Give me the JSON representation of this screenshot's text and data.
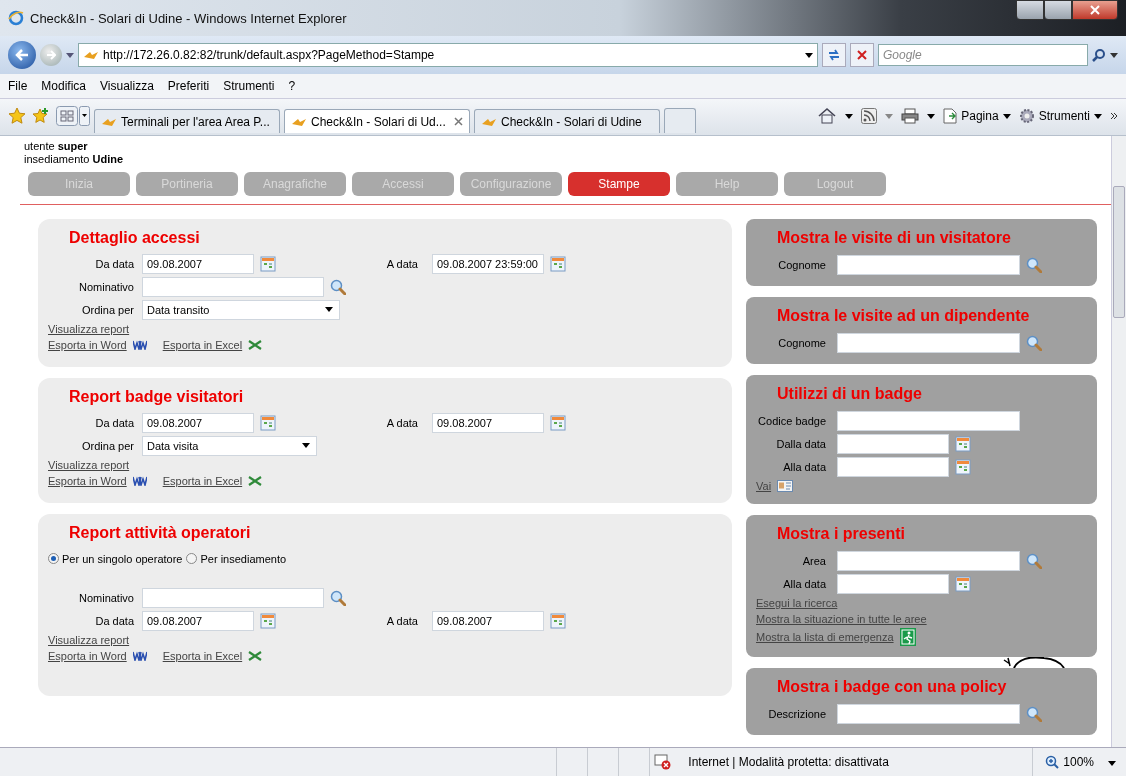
{
  "window": {
    "title": "Check&In - Solari di Udine - Windows Internet Explorer"
  },
  "address_bar": {
    "url": "http://172.26.0.82:82/trunk/default.aspx?PageMethod=Stampe"
  },
  "search": {
    "placeholder": "Google"
  },
  "menu": [
    "File",
    "Modifica",
    "Visualizza",
    "Preferiti",
    "Strumenti",
    "?"
  ],
  "tabs": [
    {
      "label": "Terminali per l'area Area P...",
      "selected": false
    },
    {
      "label": "Check&In - Solari di Ud...",
      "selected": true
    },
    {
      "label": "Check&In - Solari di Udine",
      "selected": false
    }
  ],
  "toolbar": [
    "Pagina",
    "Strumenti"
  ],
  "header": {
    "user": "utente **super**",
    "site": "insediamento **Udine**"
  },
  "nav": [
    {
      "label": "Inizia",
      "selected": false
    },
    {
      "label": "Portineria",
      "selected": false
    },
    {
      "label": "Anagrafiche",
      "selected": false
    },
    {
      "label": "Accessi",
      "selected": false
    },
    {
      "label": "Configurazione",
      "selected": false
    },
    {
      "label": "Stampe",
      "selected": true
    },
    {
      "label": "Help",
      "selected": false
    },
    {
      "label": "Logout",
      "selected": false
    }
  ],
  "left_panels": [
    {
      "title": "Dettaglio accessi",
      "rows": [
        {
          "kind": "dates",
          "from": {
            "label": "Da data",
            "value": "09.08.2007"
          },
          "to": {
            "label": "A data",
            "value": "09.08.2007 23:59:00"
          }
        },
        {
          "kind": "search",
          "label": "Nominativo"
        },
        {
          "kind": "select",
          "label": "Ordina per",
          "value": "Data transito",
          "wide": true
        },
        {
          "kind": "link",
          "label": "Visualizza report"
        },
        {
          "kind": "exports",
          "links": [
            {
              "label": "Esporta in Word",
              "kind": "word"
            },
            {
              "label": "Esporta in Excel",
              "kind": "excel"
            }
          ]
        }
      ]
    },
    {
      "title": "Report badge visitatori",
      "rows": [
        {
          "kind": "dates",
          "from": {
            "label": "Da data",
            "value": "09.08.2007"
          },
          "to": {
            "label": "A data",
            "value": "09.08.2007"
          }
        },
        {
          "kind": "select",
          "label": "Ordina per",
          "value": "Data visita",
          "wide": false
        },
        {
          "kind": "link",
          "label": "Visualizza report"
        },
        {
          "kind": "exports",
          "links": [
            {
              "label": "Esporta in Word",
              "kind": "word"
            },
            {
              "label": "Esporta in Excel",
              "kind": "excel"
            }
          ]
        }
      ]
    },
    {
      "title": "Report attività operatori",
      "rows": [
        {
          "kind": "radios",
          "options": [
            {
              "label": "Per un singolo operatore",
              "selected": true
            },
            {
              "label": "Per insediamento",
              "selected": false
            }
          ]
        },
        {
          "kind": "search",
          "label": "Nominativo"
        },
        {
          "kind": "dates",
          "from": {
            "label": "Da data",
            "value": "09.08.2007"
          },
          "to": {
            "label": "A data",
            "value": "09.08.2007"
          }
        },
        {
          "kind": "link",
          "label": "Visualizza report"
        },
        {
          "kind": "exports",
          "links": [
            {
              "label": "Esporta in Word",
              "kind": "word"
            },
            {
              "label": "Esporta in Excel",
              "kind": "excel"
            }
          ]
        }
      ]
    }
  ],
  "right_panels": [
    {
      "title": "Mostra le visite di un visitatore",
      "rows": [
        {
          "kind": "search",
          "label": "Cognome"
        }
      ]
    },
    {
      "title": "Mostra le visite ad un dipendente",
      "rows": [
        {
          "kind": "search",
          "label": "Cognome"
        }
      ]
    },
    {
      "title": "Utilizzi di un badge",
      "rows": [
        {
          "kind": "text",
          "label": "Codice badge"
        },
        {
          "kind": "date",
          "label": "Dalla data"
        },
        {
          "kind": "date",
          "label": "Alla data"
        },
        {
          "kind": "cardlink",
          "label": "Vai"
        }
      ]
    },
    {
      "title": "Mostra i presenti",
      "rows": [
        {
          "kind": "search",
          "label": "Area"
        },
        {
          "kind": "date",
          "label": "Alla data"
        },
        {
          "kind": "link",
          "label": "Esegui la ricerca"
        },
        {
          "kind": "link",
          "label": "Mostra la situazione in tutte le aree"
        },
        {
          "kind": "exitlink",
          "label": "Mostra la lista di emergenza"
        }
      ]
    },
    {
      "title": "Mostra i badge con una policy",
      "rows": [
        {
          "kind": "search",
          "label": "Descrizione"
        }
      ]
    }
  ],
  "status_bar": {
    "text": "Internet | Modalità protetta: disattivata",
    "zoom": "100%"
  }
}
